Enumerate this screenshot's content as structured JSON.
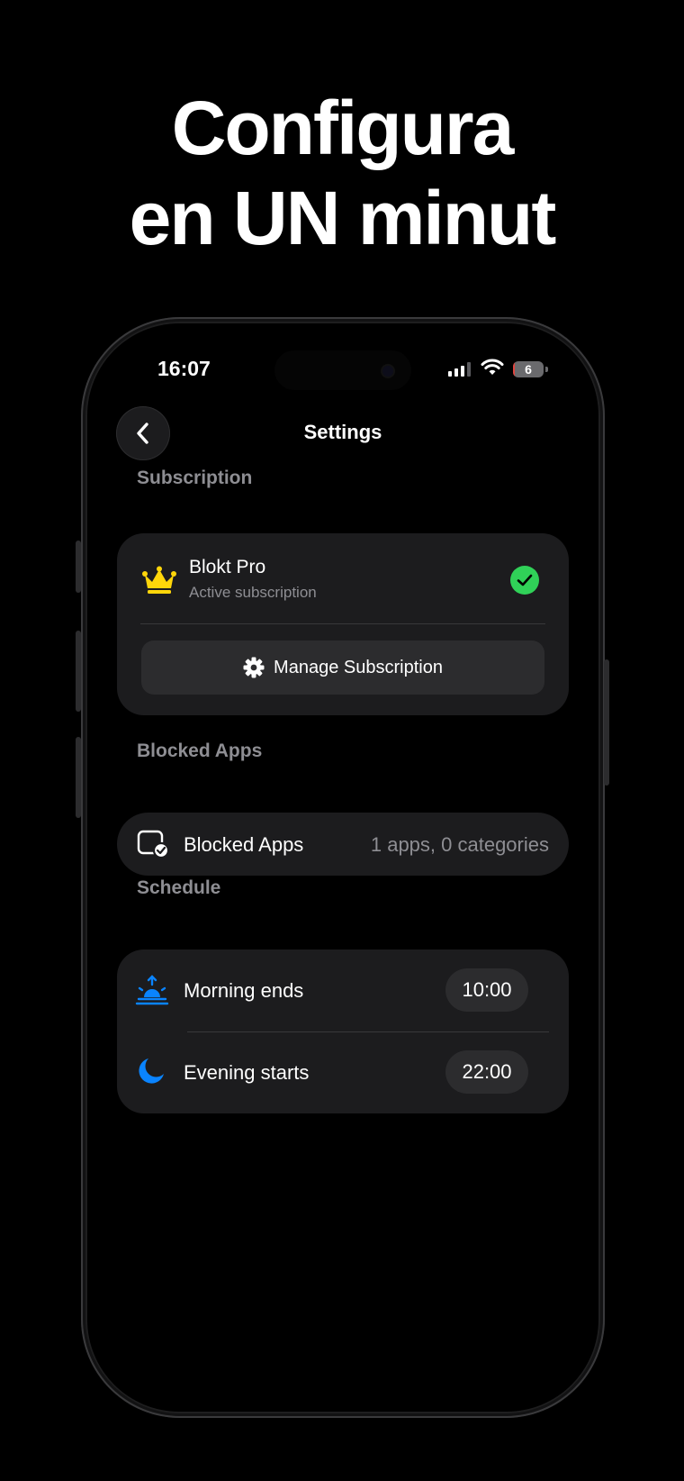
{
  "headline": {
    "line1": "Configura",
    "line2": "en UN minut"
  },
  "status_bar": {
    "time": "16:07",
    "battery": "6",
    "battery_level_percent": 6
  },
  "nav": {
    "title": "Settings",
    "back_icon": "chevron-left-icon"
  },
  "sections": {
    "subscription": "Subscription",
    "blocked_apps": "Blocked Apps",
    "schedule": "Schedule"
  },
  "subscription": {
    "plan": "Blokt Pro",
    "status": "Active subscription",
    "icon": "crown-icon",
    "status_icon": "checkmark-circle-icon",
    "manage_label": "Manage Subscription",
    "manage_icon": "gear-icon"
  },
  "blocked_apps": {
    "label": "Blocked Apps",
    "value": "1 apps, 0 categories",
    "icon": "app-check-icon"
  },
  "schedule": {
    "morning_label": "Morning ends",
    "morning_time": "10:00",
    "evening_label": "Evening starts",
    "evening_time": "22:00"
  },
  "colors": {
    "background": "#000000",
    "card": "#1c1c1e",
    "pill": "#2c2c2e",
    "secondary_text": "#8e8e93",
    "accent_blue": "#0a84ff",
    "crown_yellow": "#ffd60a",
    "check_green": "#30d158",
    "battery_red": "#e0443e"
  }
}
